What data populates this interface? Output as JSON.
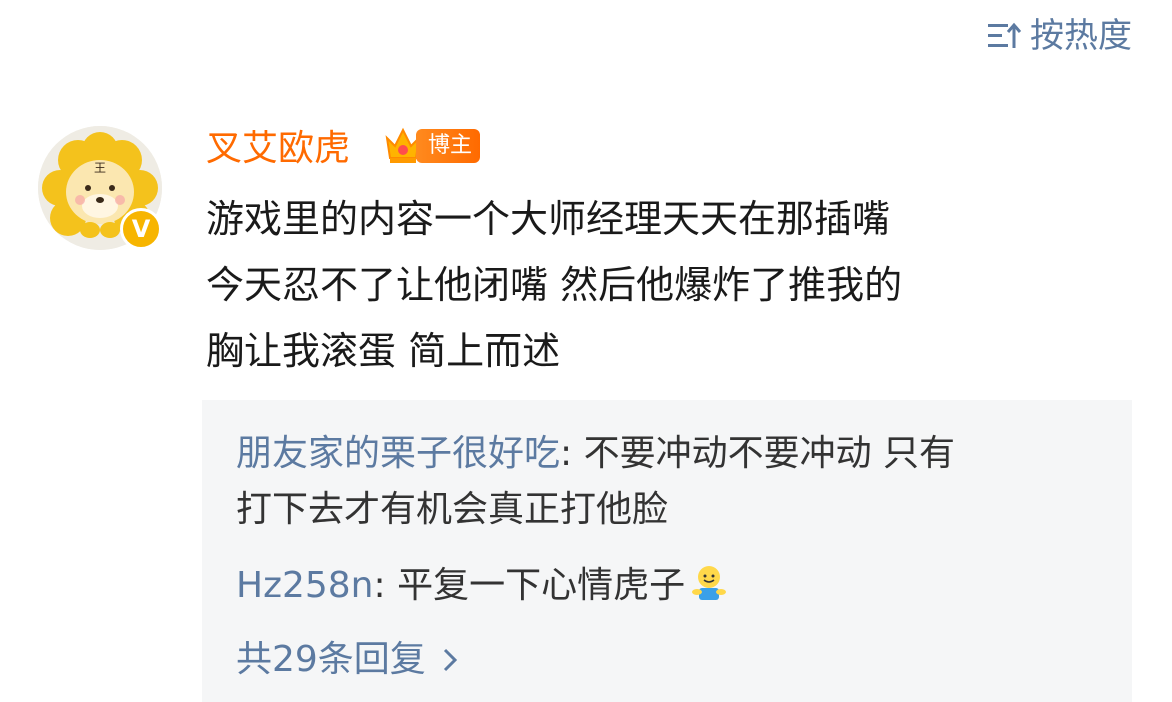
{
  "sort": {
    "label": "按热度",
    "icon": "sort-icon"
  },
  "comment": {
    "avatar_icon": "tiger-plush-avatar",
    "verified_icon": "verified-v-icon",
    "verified_text": "V",
    "username": "叉艾欧虎",
    "badge_icon": "crown-icon",
    "badge_label": "博主",
    "text_lines": [
      "游戏里的内容一个大师经理天天在那插嘴",
      "今天忍不了让他闭嘴 然后他爆炸了推我的",
      "胸让我滚蛋 简上而述"
    ]
  },
  "replies": [
    {
      "name": "朋友家的栗子很好吃",
      "line1": ": 不要冲动不要冲动 只有",
      "line2": "打下去才有机会真正打他脸"
    },
    {
      "name": "Hz258n",
      "text": ": 平复一下心情虎子",
      "emoji": "hug-emoji"
    }
  ],
  "more": {
    "label": "共29条回复",
    "icon": "chevron-right-icon"
  },
  "colors": {
    "link": "#5c7aa1",
    "username": "#ff6a00",
    "reply_bg": "#f5f6f7",
    "text": "#1a1a1a"
  }
}
